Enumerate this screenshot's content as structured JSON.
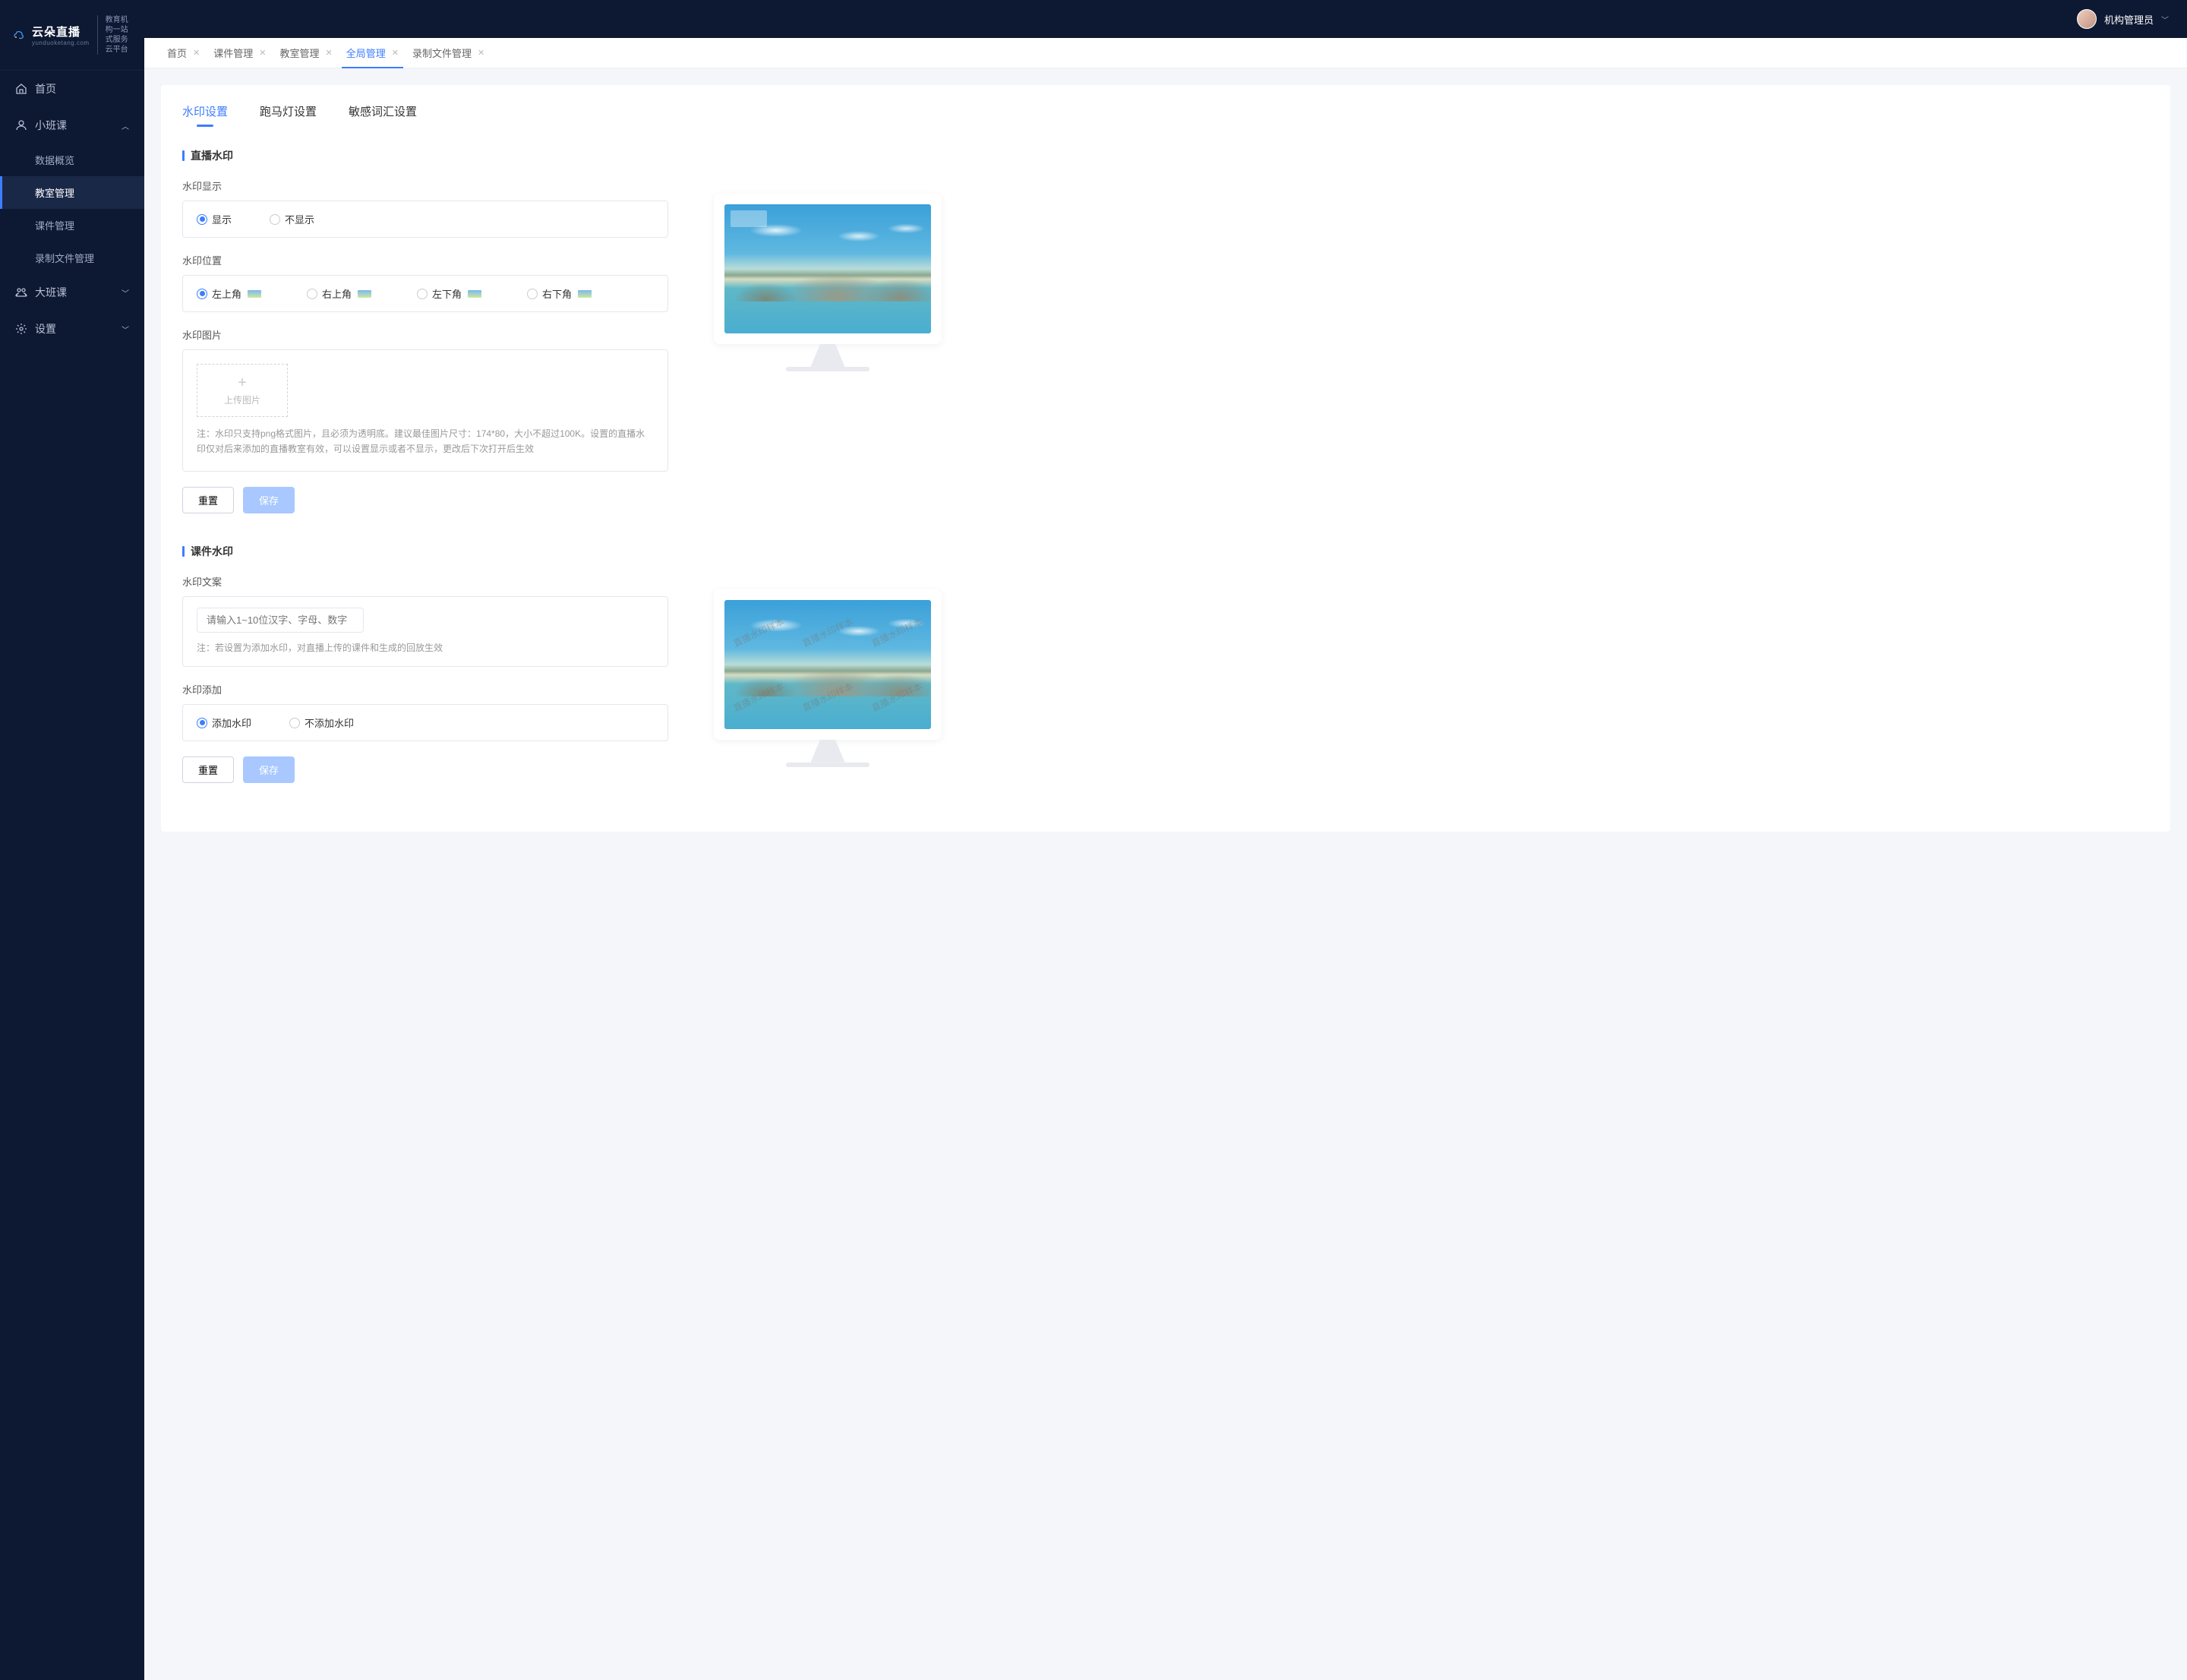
{
  "brand": {
    "name": "云朵直播",
    "domain": "yunduoketang.com",
    "tagline1": "教育机构一站",
    "tagline2": "式服务云平台"
  },
  "user": {
    "name": "机构管理员"
  },
  "sidebar": {
    "home": "首页",
    "small_class": "小班课",
    "items": [
      "数据概览",
      "教室管理",
      "课件管理",
      "录制文件管理"
    ],
    "big_class": "大班课",
    "settings": "设置"
  },
  "tabs": [
    "首页",
    "课件管理",
    "教室管理",
    "全局管理",
    "录制文件管理"
  ],
  "inner_tabs": [
    "水印设置",
    "跑马灯设置",
    "敏感词汇设置"
  ],
  "section1": {
    "title": "直播水印",
    "display_label": "水印显示",
    "opt_show": "显示",
    "opt_hide": "不显示",
    "position_label": "水印位置",
    "pos": [
      "左上角",
      "右上角",
      "左下角",
      "右下角"
    ],
    "image_label": "水印图片",
    "upload": "上传图片",
    "note": "注：水印只支持png格式图片，且必须为透明底。建议最佳图片尺寸：174*80，大小不超过100K。设置的直播水印仅对后来添加的直播教室有效，可以设置显示或者不显示，更改后下次打开后生效"
  },
  "section2": {
    "title": "课件水印",
    "text_label": "水印文案",
    "placeholder": "请输入1~10位汉字、字母、数字",
    "note": "注：若设置为添加水印，对直播上传的课件和生成的回放生效",
    "add_label": "水印添加",
    "opt_add": "添加水印",
    "opt_noadd": "不添加水印",
    "sample_text": "直播水印样本"
  },
  "buttons": {
    "reset": "重置",
    "save": "保存"
  }
}
